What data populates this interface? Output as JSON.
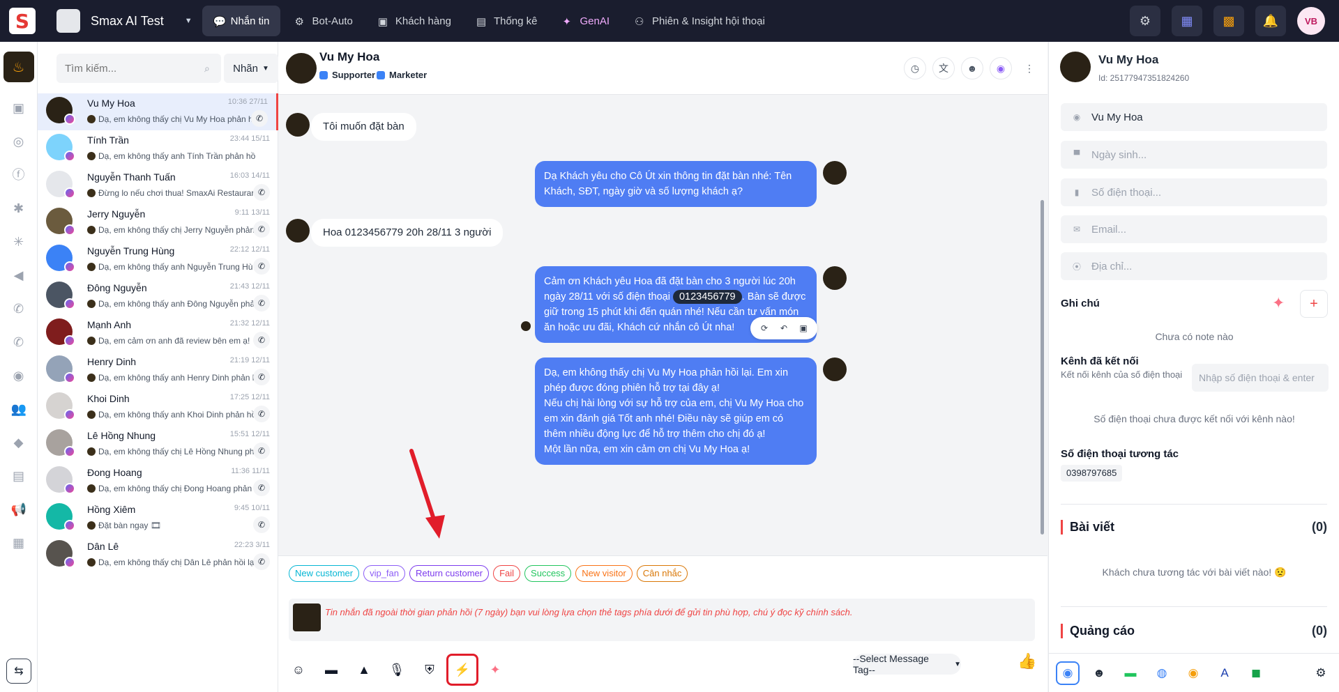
{
  "app": {
    "logo": "S",
    "workspace_name": "Smax AI Test"
  },
  "topnav": [
    {
      "label": "Nhắn tin",
      "icon": "chat-icon",
      "active": true
    },
    {
      "label": "Bot-Auto",
      "icon": "bot-icon"
    },
    {
      "label": "Khách hàng",
      "icon": "contact-icon"
    },
    {
      "label": "Thống kê",
      "icon": "chart-icon"
    },
    {
      "label": "GenAI",
      "icon": "sparkle-icon"
    },
    {
      "label": "Phiên & Insight hội thoại",
      "icon": "insight-icon"
    }
  ],
  "user_avatar_text": "VB",
  "search": {
    "placeholder": "Tìm kiếm..."
  },
  "label_filter": "Nhãn",
  "conversations": [
    {
      "name": "Vu My Hoa",
      "time": "10:36 27/11",
      "preview": "Dạ, em không thấy chị Vu My Hoa phản h",
      "avatar_color": "#2a2216"
    },
    {
      "name": "Tính Trần",
      "time": "23:44 15/11",
      "preview": "Dạ, em không thấy anh Tính Trần phản hồ",
      "avatar_color": "#7dd3fc"
    },
    {
      "name": "Nguyễn Thanh Tuấn",
      "time": "16:03 14/11",
      "preview": "Đừng lo nếu chơi thua! SmaxAi Restaurar",
      "avatar_color": "#e5e7eb"
    },
    {
      "name": "Jerry Nguyễn",
      "time": "9:11 13/11",
      "preview": "Dạ, em không thấy chị Jerry Nguyễn phản",
      "avatar_color": "#6b5b3e"
    },
    {
      "name": "Nguyễn Trung Hùng",
      "time": "22:12 12/11",
      "preview": "Dạ, em không thấy anh Nguyễn Trung Hù",
      "avatar_color": "#3b82f6"
    },
    {
      "name": "Đông Nguyễn",
      "time": "21:43 12/11",
      "preview": "Dạ, em không thấy anh Đông Nguyễn phả",
      "avatar_color": "#4b5563"
    },
    {
      "name": "Mạnh Anh",
      "time": "21:32 12/11",
      "preview": "Dạ, em cảm ơn anh đã review bên em ạ!",
      "avatar_color": "#7f1d1d"
    },
    {
      "name": "Henry Dinh",
      "time": "21:19 12/11",
      "preview": "Dạ, em không thấy anh Henry Dinh phản l",
      "avatar_color": "#94a3b8"
    },
    {
      "name": "Khoi Dinh",
      "time": "17:25 12/11",
      "preview": "Dạ, em không thấy anh Khoi Dinh phản hồ",
      "avatar_color": "#d6d3d1"
    },
    {
      "name": "Lê Hồng Nhung",
      "time": "15:51 12/11",
      "preview": "Dạ, em không thấy chị Lê Hồng Nhung ph",
      "avatar_color": "#a8a29e"
    },
    {
      "name": "Đong Hoang",
      "time": "11:36 11/11",
      "preview": "Dạ, em không thấy chị Đong Hoang phản",
      "avatar_color": "#d4d4d8"
    },
    {
      "name": "Hồng Xiêm",
      "time": "9:45 10/11",
      "preview": "Đặt bàn ngay 🎞",
      "avatar_color": "#14b8a6"
    },
    {
      "name": "Dân Lê",
      "time": "22:23 3/11",
      "preview": "Dạ, em không thấy chị Dân Lê phản hồi lạ",
      "avatar_color": "#57534e"
    }
  ],
  "chat": {
    "name": "Vu My Hoa",
    "tags": [
      "Supporter",
      "Marketer"
    ],
    "messages": {
      "m1": "Tôi muốn đặt bàn",
      "m2": "Dạ Khách yêu cho Cô Út xin thông tin đặt bàn nhé: Tên Khách, SĐT, ngày giờ và số lượng khách ạ?",
      "m3": "Hoa 0123456779 20h 28/11 3 người",
      "m4_a": "Cảm ơn Khách yêu Hoa đã đặt bàn cho 3 người lúc 20h ngày 28/11 với số điện thoại",
      "m4_phone": "0123456779",
      "m4_b": ". Bàn sẽ được giữ trong 15 phút khi đến quán nhé! Nếu cần tư vấn món ăn hoặc ưu đãi, Khách cứ nhắn cô Út nha!",
      "m5_l1": "Dạ, em không thấy chị Vu My Hoa phản hồi lại. Em xin phép được đóng phiên hỗ trợ tại đây ạ!",
      "m5_l2": "Nếu chị hài lòng với sự hỗ trợ của em, chị Vu My Hoa cho em xin đánh giá Tốt anh nhé! Điều này sẽ giúp em có thêm nhiều động lực để hỗ trợ thêm cho chị đó ạ!",
      "m5_l3": "Một lần nữa, em xin cảm ơn chị Vu My Hoa ạ!"
    }
  },
  "composer": {
    "tags": [
      {
        "label": "New customer",
        "color": "#06b6d4"
      },
      {
        "label": "vip_fan",
        "color": "#8b5cf6"
      },
      {
        "label": "Return customer",
        "color": "#7c3aed"
      },
      {
        "label": "Fail",
        "color": "#ef4444"
      },
      {
        "label": "Success",
        "color": "#22c55e"
      },
      {
        "label": "New visitor",
        "color": "#f97316"
      },
      {
        "label": "Cân nhắc",
        "color": "#d97706"
      }
    ],
    "warning": "Tin nhắn đã ngoài thời gian phản hồi (7 ngày) bạn vui lòng lựa chọn thẻ tags phía dưới để gửi tin phù hợp, chú ý đọc kỹ chính sách.",
    "message_tag_select": "--Select Message Tag--"
  },
  "profile": {
    "name": "Vu My Hoa",
    "id": "Id: 25177947351824260",
    "fields": {
      "name_value": "Vu My Hoa",
      "birthday_placeholder": "Ngày sinh...",
      "phone_placeholder": "Số điện thoại...",
      "email_placeholder": "Email...",
      "address_placeholder": "Địa chỉ..."
    },
    "notes_title": "Ghi chú",
    "notes_empty": "Chưa có note nào",
    "channel_title": "Kênh đã kết nối",
    "channel_desc": "Kết nối kênh của số điện thoại",
    "channel_input_placeholder": "Nhập số điện thoại & enter",
    "channel_empty": "Số điện thoại chưa được kết nối với kênh nào!",
    "phone_title": "Số điện thoại tương tác",
    "phone_value": "0398797685",
    "posts_title": "Bài viết",
    "posts_count": "(0)",
    "posts_empty": "Khách chưa tương tác với bài viết nào! 😟",
    "ads_title": "Quảng cáo",
    "ads_count": "(0)"
  }
}
